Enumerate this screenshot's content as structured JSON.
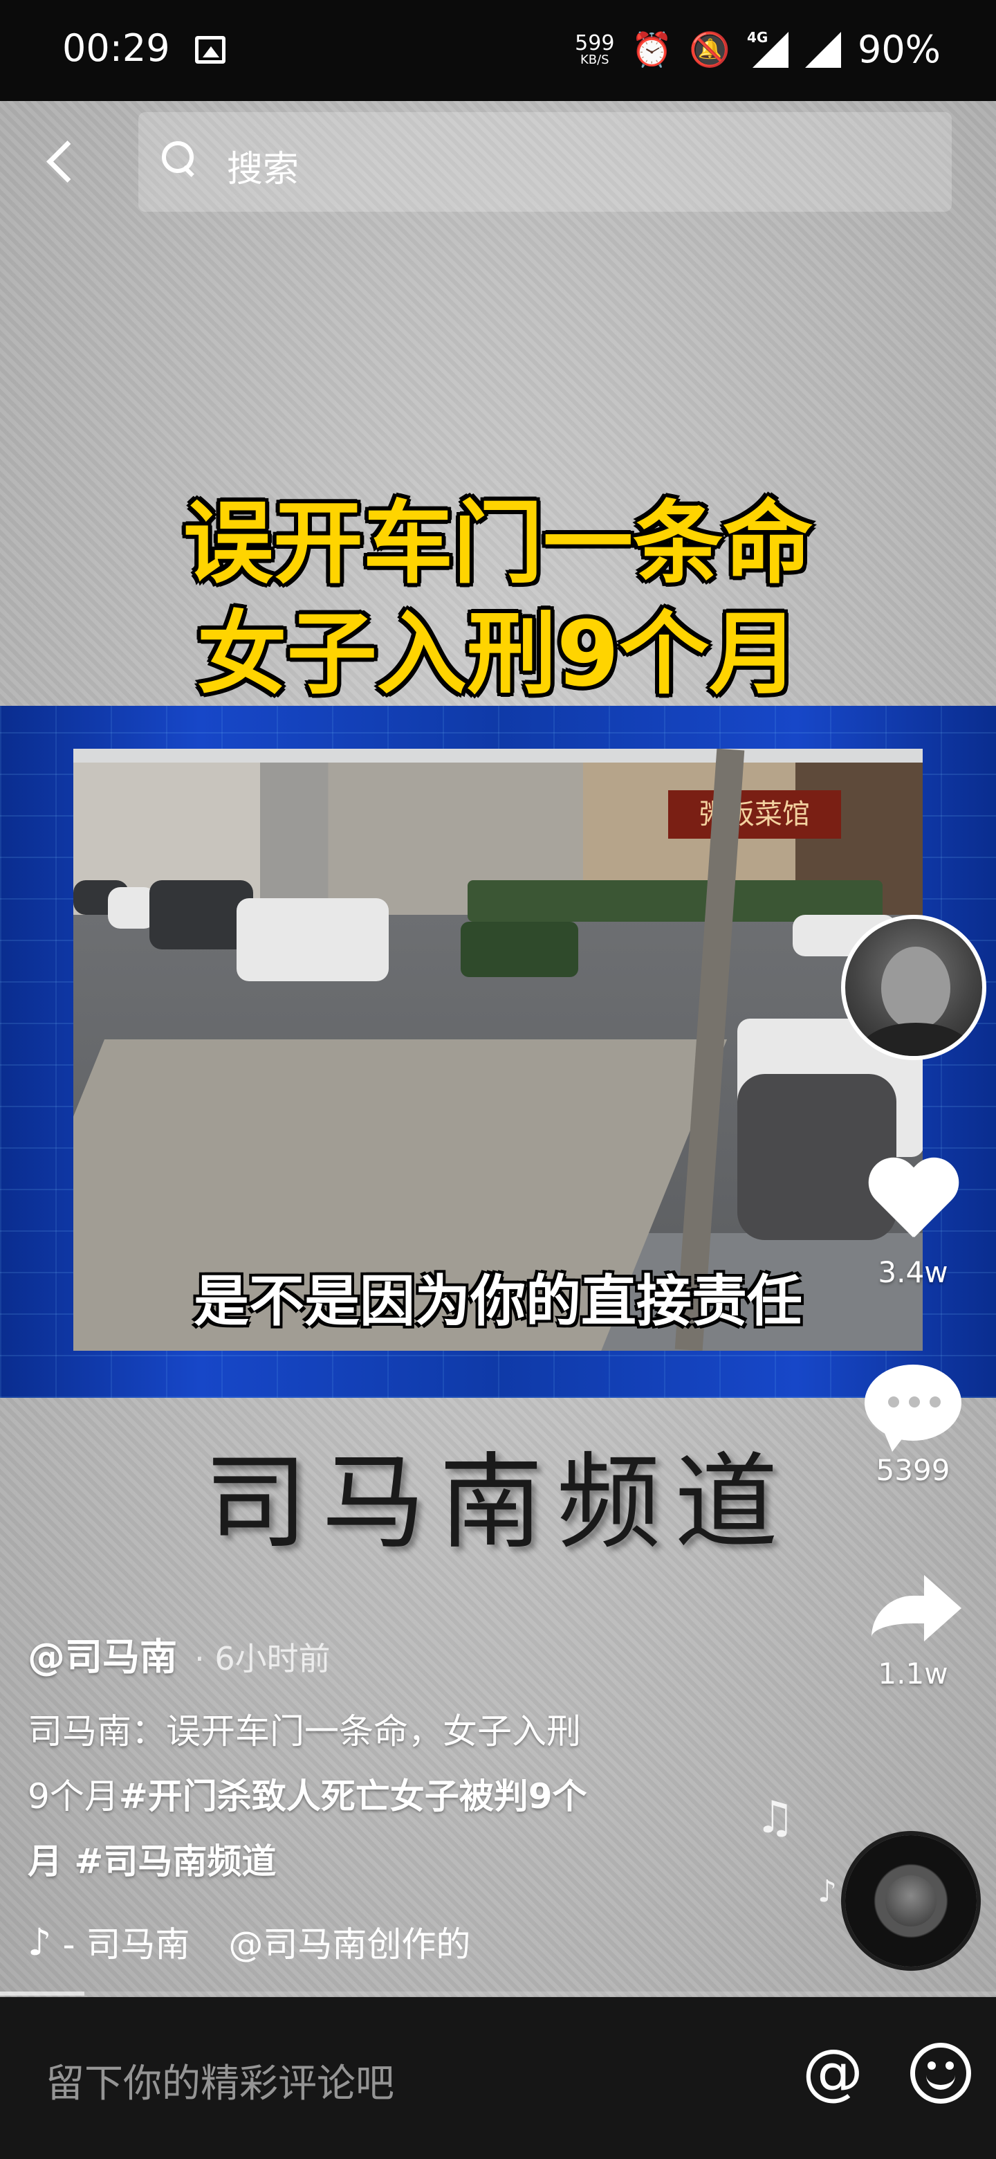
{
  "status_bar": {
    "time": "00:29",
    "net_speed": "599",
    "net_unit": "KB/S",
    "network": "4G",
    "battery": "90%"
  },
  "search": {
    "placeholder": "搜索"
  },
  "video": {
    "headline_line1": "误开车门一条命",
    "headline_line2": "女子入刑9个月",
    "shop_sign": "粥饭菜馆",
    "subtitle": "是不是因为你的直接责任",
    "channel_logo": "司马南频道",
    "progress": 0.085
  },
  "actions": {
    "likes": "3.4w",
    "comments": "5399",
    "shares": "1.1w"
  },
  "post": {
    "author": "@司马南",
    "time": "· 6小时前",
    "caption_line1": "司马南：误开车门一条命，女子入刑",
    "caption_line2_text": "9个月",
    "caption_line2_tag": "#开门杀致人死亡女子被判9个",
    "caption_line3_text": "月 ",
    "caption_line3_tag": "#司马南频道",
    "music": "- 司马南",
    "music_credit": "@司马南创作的"
  },
  "comment_bar": {
    "placeholder": "留下你的精彩评论吧",
    "at_symbol": "@"
  },
  "icons": [
    "back-icon",
    "search-icon",
    "heart-icon",
    "comment-icon",
    "share-icon",
    "music-note-icon",
    "tiktok-note-icon",
    "emoji-icon"
  ]
}
